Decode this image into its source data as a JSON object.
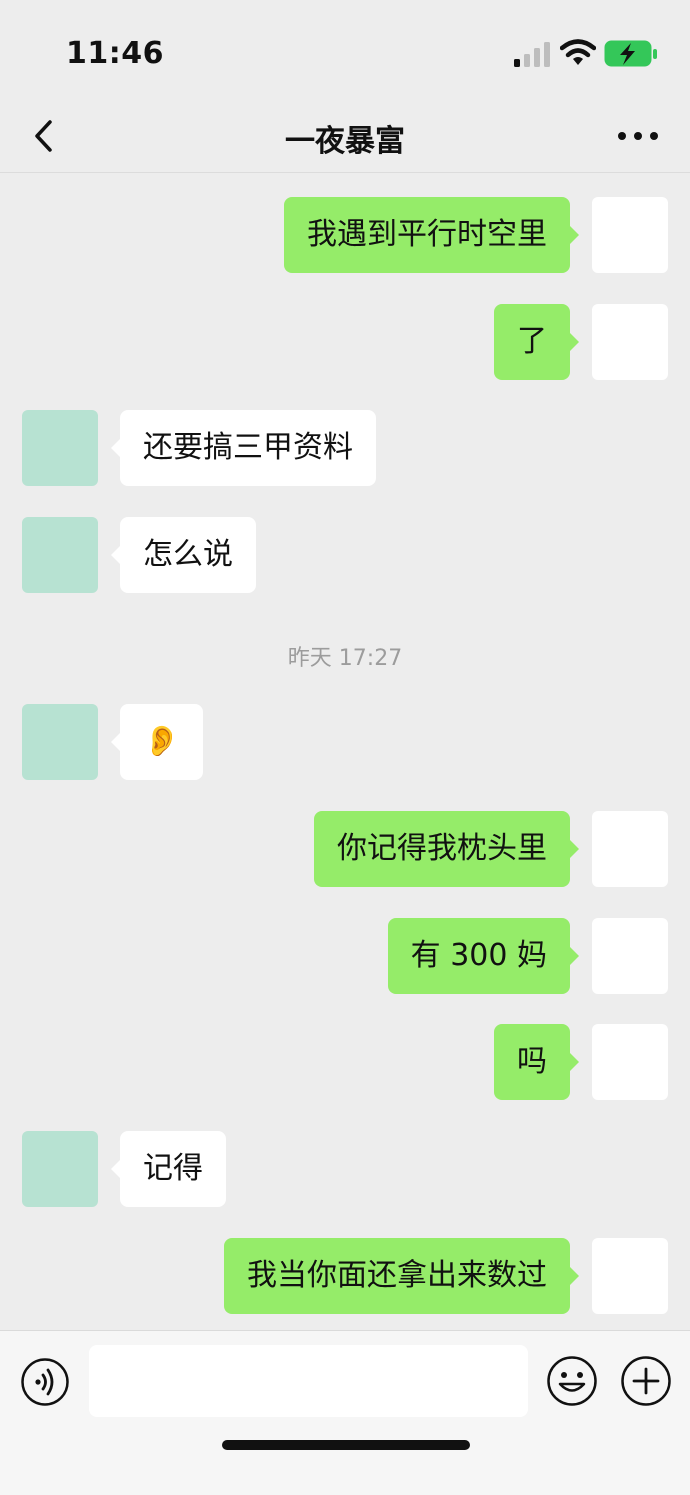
{
  "status_bar": {
    "time": "11:46"
  },
  "header": {
    "title": "一夜暴富"
  },
  "messages": [
    {
      "side": "sent",
      "text": "我遇到平行时空里"
    },
    {
      "side": "sent",
      "text": "了"
    },
    {
      "side": "recv",
      "text": "还要搞三甲资料"
    },
    {
      "side": "recv",
      "text": "怎么说"
    },
    {
      "side": "recv",
      "text": "👂"
    },
    {
      "side": "sent",
      "text": "你记得我枕头里"
    },
    {
      "side": "sent",
      "text": "有 300 妈"
    },
    {
      "side": "sent",
      "text": "吗"
    },
    {
      "side": "recv",
      "text": "记得"
    },
    {
      "side": "sent",
      "text": "我当你面还拿出来数过"
    }
  ],
  "timestamp": "昨天 17:27",
  "colors": {
    "sent_bubble": "#95ec69",
    "recv_bubble": "#ffffff",
    "background": "#ededed"
  },
  "icons": {
    "back": "chevron-left-icon",
    "more": "more-horizontal-icon",
    "voice": "voice-icon",
    "emoji": "emoji-icon",
    "plus": "plus-icon"
  }
}
